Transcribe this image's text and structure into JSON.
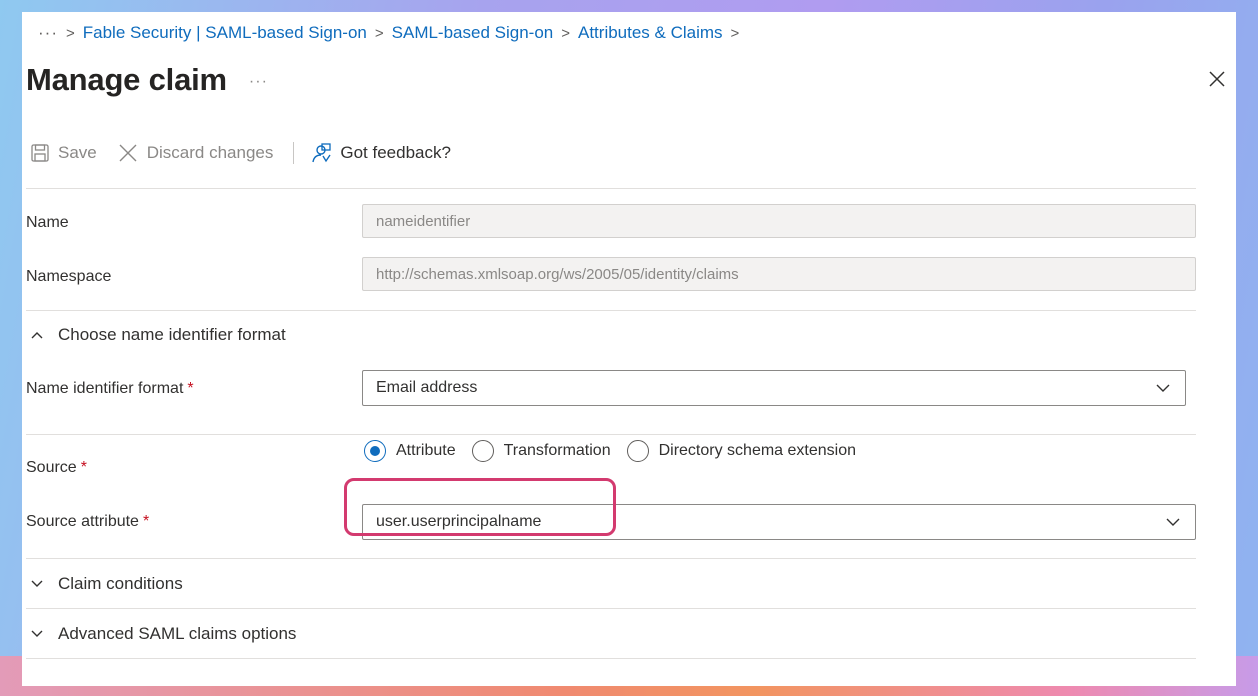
{
  "breadcrumb": {
    "more": "···",
    "items": [
      "Fable Security | SAML-based Sign-on",
      "SAML-based Sign-on",
      "Attributes & Claims"
    ],
    "separator": ">"
  },
  "header": {
    "title": "Manage claim",
    "more": "···"
  },
  "toolbar": {
    "save_label": "Save",
    "discard_label": "Discard changes",
    "feedback_label": "Got feedback?"
  },
  "form": {
    "name": {
      "label": "Name",
      "value": "nameidentifier"
    },
    "namespace": {
      "label": "Namespace",
      "value": "http://schemas.xmlsoap.org/ws/2005/05/identity/claims"
    },
    "name_id_section": {
      "label": "Choose name identifier format",
      "expanded": true
    },
    "name_id_format": {
      "label": "Name identifier format",
      "required_mark": "*",
      "value": "Email address"
    },
    "source": {
      "label": "Source",
      "required_mark": "*",
      "options": [
        "Attribute",
        "Transformation",
        "Directory schema extension"
      ],
      "selected": "Attribute"
    },
    "source_attribute": {
      "label": "Source attribute",
      "required_mark": "*",
      "value": "user.userprincipalname"
    },
    "claim_conditions": {
      "label": "Claim conditions",
      "expanded": false
    },
    "advanced_options": {
      "label": "Advanced SAML claims options",
      "expanded": false
    }
  },
  "colors": {
    "link": "#0f6cbd",
    "required": "#c50f1f",
    "highlight": "#d33a6f",
    "radio_selected": "#0f6cbd"
  }
}
